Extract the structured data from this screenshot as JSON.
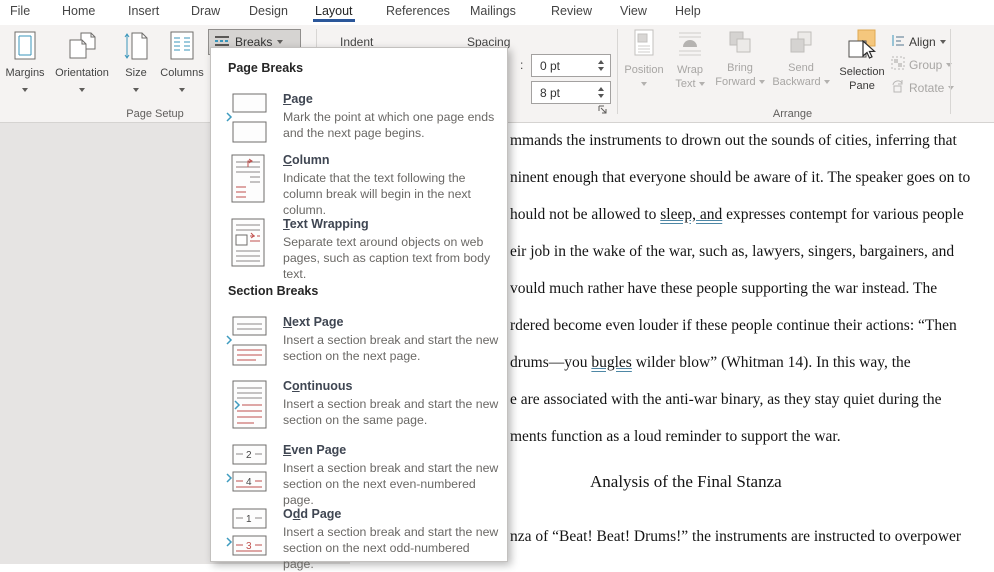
{
  "menu": {
    "tabs": [
      {
        "label": "File"
      },
      {
        "label": "Home"
      },
      {
        "label": "Insert"
      },
      {
        "label": "Draw"
      },
      {
        "label": "Design"
      },
      {
        "label": "Layout"
      },
      {
        "label": "References"
      },
      {
        "label": "Mailings"
      },
      {
        "label": "Review"
      },
      {
        "label": "View"
      },
      {
        "label": "Help"
      }
    ],
    "active_tab": "Layout"
  },
  "ribbon": {
    "page_setup": {
      "label": "Page Setup",
      "margins": "Margins",
      "orientation": "Orientation",
      "size": "Size",
      "columns": "Columns",
      "breaks": "Breaks"
    },
    "paragraph": {
      "indent_label": "Indent",
      "spacing_label": "Spacing",
      "colon_fragment": ":",
      "spacing_before_value": "0 pt",
      "spacing_after_value": "8 pt"
    },
    "arrange": {
      "label": "Arrange",
      "position": "Position",
      "wrap_line1": "Wrap",
      "wrap_line2": "Text",
      "bring_line1": "Bring",
      "bring_line2": "Forward",
      "send_line1": "Send",
      "send_line2": "Backward",
      "selection_line1": "Selection",
      "selection_line2": "Pane",
      "align": "Align",
      "group": "Group",
      "rotate": "Rotate"
    }
  },
  "breaks_menu": {
    "header1": "Page Breaks",
    "header2": "Section Breaks",
    "items": [
      {
        "pre": "",
        "accel": "P",
        "post": "age",
        "desc": "Mark the point at which one page ends and the next page begins.",
        "icon": "page-break-icon"
      },
      {
        "pre": "",
        "accel": "C",
        "post": "olumn",
        "desc": "Indicate that the text following the column break will begin in the next column.",
        "icon": "column-break-icon"
      },
      {
        "pre": "",
        "accel": "T",
        "post": "ext Wrapping",
        "desc": "Separate text around objects on web pages, such as caption text from body text.",
        "icon": "text-wrapping-break-icon"
      },
      {
        "pre": "",
        "accel": "N",
        "post": "ext Page",
        "desc": "Insert a section break and start the new section on the next page.",
        "icon": "next-page-break-icon"
      },
      {
        "pre": "C",
        "accel": "o",
        "post": "ntinuous",
        "desc": "Insert a section break and start the new section on the same page.",
        "icon": "continuous-break-icon"
      },
      {
        "pre": "",
        "accel": "E",
        "post": "ven Page",
        "desc": "Insert a section break and start the new section on the next even-numbered page.",
        "icon": "even-page-break-icon"
      },
      {
        "pre": "O",
        "accel": "d",
        "post": "d Page",
        "desc": "Insert a section break and start the new section on the next odd-numbered page.",
        "icon": "odd-page-break-icon"
      }
    ]
  },
  "document": {
    "lines": [
      {
        "text": "mmands the instruments to drown out the sounds of cities, inferring that"
      },
      {
        "text": "ninent enough that everyone should be aware of it. The speaker goes on to"
      },
      {
        "pre": "hould not be allowed to ",
        "u": "sleep, and",
        "post": " expresses contempt for various people"
      },
      {
        "text": "eir job in the wake of the war, such as, lawyers, singers, bargainers, and"
      },
      {
        "text": "vould much rather have these people supporting the war instead. The"
      },
      {
        "text": "rdered become even louder if these people continue their actions: “Then"
      },
      {
        "pre": "drums—you ",
        "u": "bugles",
        "post": " wilder blow” (Whitman 14). In this way, the"
      },
      {
        "text": "e are associated with the anti-war binary, as they stay quiet during the"
      },
      {
        "text": "ments function as a loud reminder to support the war."
      }
    ],
    "heading": "Analysis of the Final Stanza",
    "last_line": "nza of “Beat! Beat! Drums!” the instruments are instructed to overpower"
  },
  "colors": {
    "accent": "#2b579a",
    "break_red": "#c0504d",
    "chevron_teal": "#3e9bbf",
    "selection_orange": "#f5c77d"
  }
}
